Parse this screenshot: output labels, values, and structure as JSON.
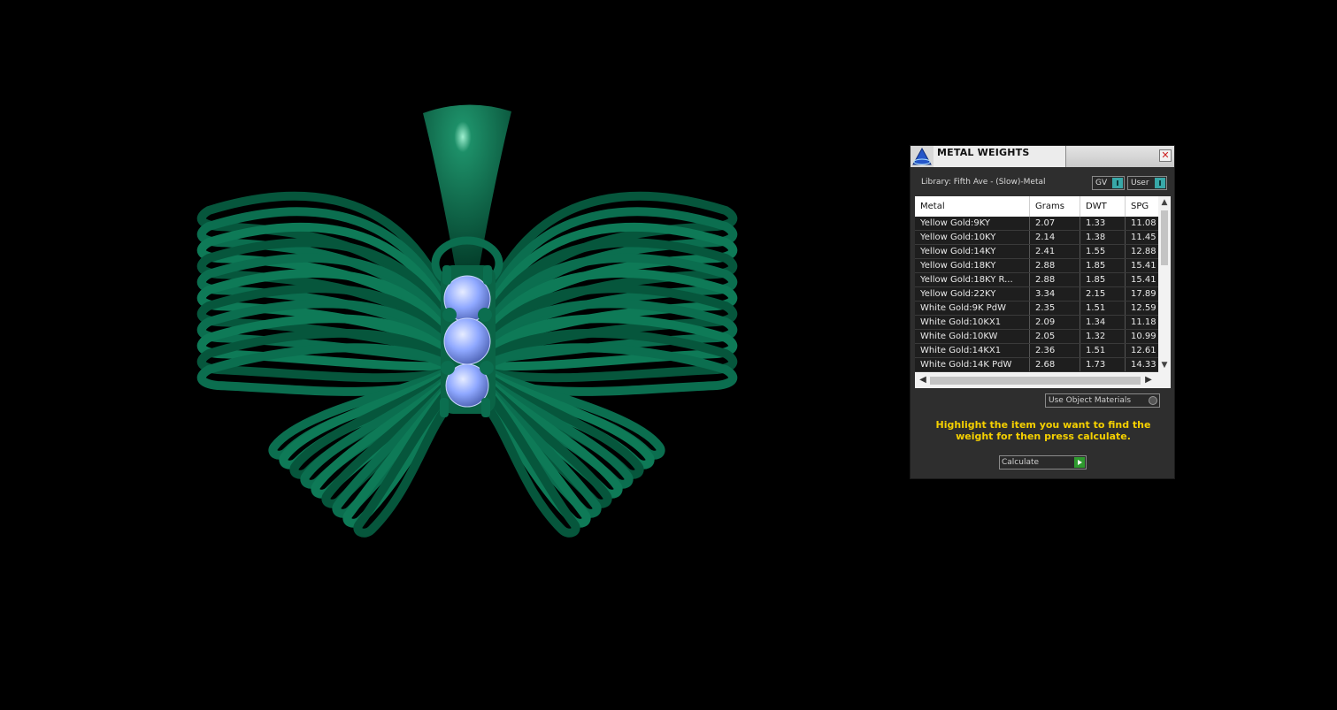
{
  "panel": {
    "title": "METAL WEIGHTS",
    "close_glyph": "✕",
    "library_label": "Library: Fifth Ave - (Slow)-Metal",
    "toggles": {
      "gv": "GV",
      "user": "User"
    },
    "table": {
      "headers": [
        "Metal",
        "Grams",
        "DWT",
        "SPG"
      ],
      "rows": [
        [
          "Yellow Gold:9KY",
          "2.07",
          "1.33",
          "11.08"
        ],
        [
          "Yellow Gold:10KY",
          "2.14",
          "1.38",
          "11.45"
        ],
        [
          "Yellow Gold:14KY",
          "2.41",
          "1.55",
          "12.88"
        ],
        [
          "Yellow Gold:18KY",
          "2.88",
          "1.85",
          "15.41"
        ],
        [
          "Yellow Gold:18KY R...",
          "2.88",
          "1.85",
          "15.41"
        ],
        [
          "Yellow Gold:22KY",
          "3.34",
          "2.15",
          "17.89"
        ],
        [
          "White Gold:9K PdW",
          "2.35",
          "1.51",
          "12.59"
        ],
        [
          "White Gold:10KX1",
          "2.09",
          "1.34",
          "11.18"
        ],
        [
          "White Gold:10KW",
          "2.05",
          "1.32",
          "10.99"
        ],
        [
          "White Gold:14KX1",
          "2.36",
          "1.51",
          "12.61"
        ],
        [
          "White Gold:14K PdW",
          "2.68",
          "1.73",
          "14.33"
        ]
      ]
    },
    "use_object_materials_label": "Use Object Materials",
    "instruction": "Highlight the item you want to find the weight for then press calculate.",
    "calculate_label": "Calculate"
  },
  "colors": {
    "background": "#000000",
    "metal_green": "#0b6e4f",
    "gem_blue": "#8fa8ff",
    "instruction_yellow": "#f5d000"
  }
}
